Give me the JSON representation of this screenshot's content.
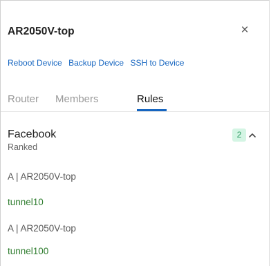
{
  "panel": {
    "title": "AR2050V-top",
    "close_glyph": "×",
    "close_icon": "close-icon"
  },
  "actions": {
    "reboot_label": "Reboot Device",
    "backup_label": "Backup Device",
    "ssh_label": "SSH to Device"
  },
  "tabs": [
    {
      "label": "Router",
      "active": false
    },
    {
      "label": "Members",
      "active": false
    },
    {
      "label": "Rules",
      "active": true
    }
  ],
  "rule": {
    "name": "Facebook",
    "subtitle": "Ranked",
    "count": "2",
    "chevron_icon": "chevron-up-icon",
    "members": [
      {
        "device": "A | AR2050V-top",
        "interface": "tunnel10"
      },
      {
        "device": "A | AR2050V-top",
        "interface": "tunnel100"
      }
    ]
  },
  "colors": {
    "accent": "#1565c0",
    "interface_text": "#2f7d2f",
    "badge_bg": "#d4f5e4",
    "badge_text": "#2e9c63"
  }
}
